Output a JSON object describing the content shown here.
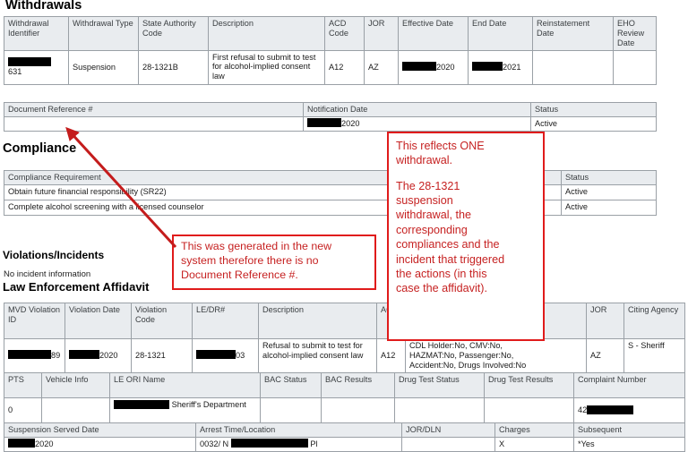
{
  "sections": {
    "withdrawals_title": "Withdrawals",
    "compliance_title": "Compliance",
    "violations_title": "Violations/Incidents",
    "violations_note": "No incident information",
    "affidavit_title": "Law Enforcement Affidavit"
  },
  "withdrawals": {
    "columns": [
      "Withdrawal Identifier",
      "Withdrawal Type",
      "State Authority Code",
      "Description",
      "ACD Code",
      "JOR",
      "Effective Date",
      "End Date",
      "Reinstatement Date",
      "EHO Review Date"
    ],
    "row": {
      "withdrawal_identifier": "631",
      "withdrawal_type": "Suspension",
      "state_authority_code": "28-1321B",
      "description": "First refusal to submit to test for alcohol-implied consent law",
      "acd_code": "A12",
      "jor": "AZ",
      "effective_date": "2020",
      "end_date": "2021",
      "reinstatement_date": "",
      "eho_review_date": ""
    },
    "subheaders": [
      "Document Reference #",
      "Notification Date",
      "Status"
    ],
    "subrow": {
      "document_reference": "",
      "notification_date": "2020",
      "status": "Active"
    }
  },
  "compliance": {
    "columns": [
      "Compliance Requirement",
      "Status"
    ],
    "rows": [
      {
        "requirement": "Obtain future financial responsibility (SR22)",
        "status": "Active"
      },
      {
        "requirement": "Complete alcohol screening with a licensed counselor",
        "status": "Active"
      }
    ]
  },
  "affidavit": {
    "block1_columns": [
      "MVD Violation ID",
      "Violation Date",
      "Violation Code",
      "LE/DR#",
      "Description",
      "ACD",
      "",
      "JOR",
      "Citing Agency"
    ],
    "block1_row": {
      "mvd_violation_id": "89",
      "violation_date": "2020",
      "violation_code": "28-1321",
      "le_dr": "03",
      "description": "Refusal to submit to test for alcohol-implied consent law",
      "acd": "A12",
      "flags_line1": "CDL Holder:No, CMV:No,",
      "flags_line2": "HAZMAT:No, Passenger:No,",
      "flags_line3": "Accident:No, Drugs Involved:No",
      "jor": "AZ",
      "citing_agency": "S - Sheriff"
    },
    "block2_columns": [
      "PTS",
      "Vehicle Info",
      "LE ORI Name",
      "BAC Status",
      "BAC Results",
      "Drug Test Status",
      "Drug Test Results",
      "Complaint Number"
    ],
    "block2_row": {
      "pts": "0",
      "vehicle_info": "",
      "le_ori_name": "Sheriff's Department",
      "bac_status": "",
      "bac_results": "",
      "drug_test_status": "",
      "drug_test_results": "",
      "complaint_number": "42"
    },
    "block3_columns": [
      "Suspension Served Date",
      "Arrest Time/Location",
      "JOR/DLN",
      "Charges",
      "Subsequent"
    ],
    "block3_row": {
      "suspension_served_date": "2020",
      "arrest_time": "0032/ N",
      "arrest_location_suffix": "Pl",
      "jor_dln": "",
      "charges": "X",
      "subsequent": "*Yes"
    }
  },
  "annotations": {
    "doc_ref": {
      "line1": "This was generated in the new",
      "line2": "system therefore there is no",
      "line3": "Document Reference #."
    },
    "one_withdrawal": {
      "line1": "This reflects ONE",
      "line2": "withdrawal.",
      "line3": "The 28-1321",
      "line4": "suspension",
      "line5": "withdrawal, the",
      "line6": "corresponding",
      "line7": "compliances and the",
      "line8": "incident that triggered",
      "line9": "the actions (in this",
      "line10": "case the affidavit)."
    }
  },
  "colors": {
    "annotation_red": "#c62222",
    "annotation_border": "#e01b1b",
    "header_fill": "#e9ecef",
    "grid_line": "#9aa0a6",
    "redaction": "#000000"
  }
}
